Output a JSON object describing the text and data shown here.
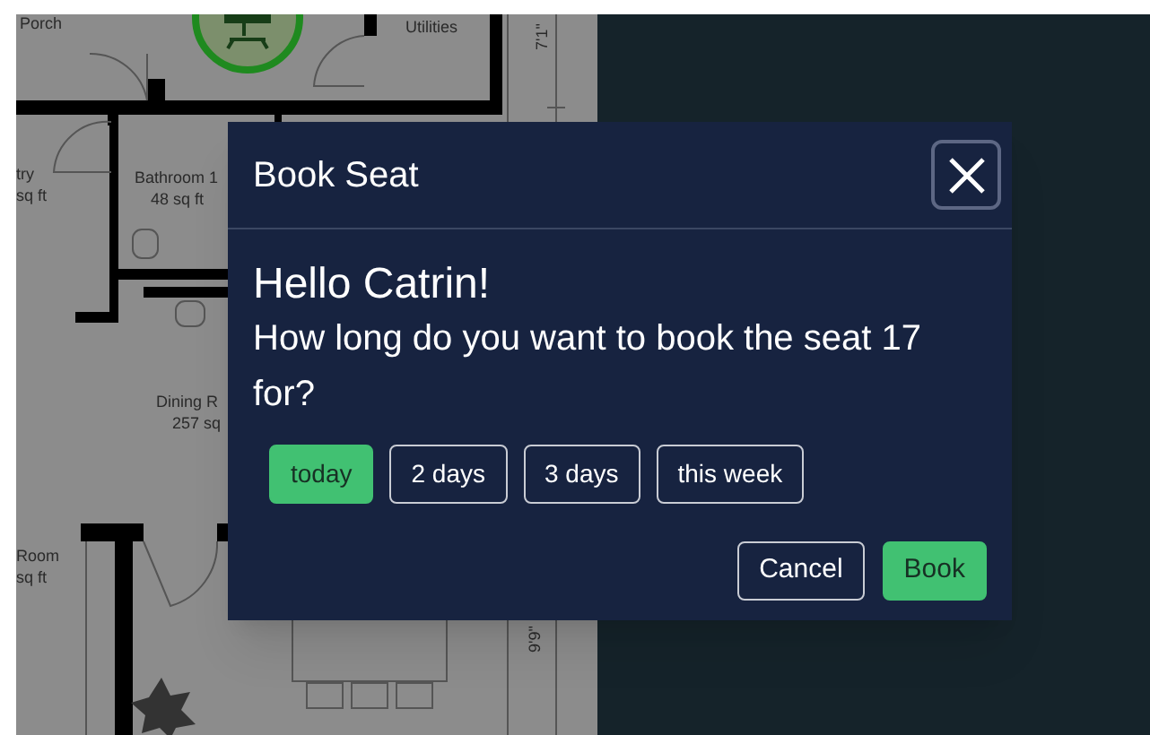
{
  "floor_plan": {
    "labels": [
      "Porch",
      "Utilities",
      "7'1\"",
      "try",
      "sq ft",
      "Bathroom 1",
      "48 sq ft",
      "Dining R",
      "257 sq",
      "Room",
      "sq ft",
      "9'9\""
    ]
  },
  "dialog": {
    "title": "Book Seat",
    "greeting": "Hello Catrin!",
    "question": "How long do you want to book the seat 17 for?",
    "options": [
      {
        "label": "today",
        "selected": true
      },
      {
        "label": "2 days",
        "selected": false
      },
      {
        "label": "3 days",
        "selected": false
      },
      {
        "label": "this week",
        "selected": false
      }
    ],
    "buttons": [
      {
        "label": "Cancel",
        "kind": "secondary"
      },
      {
        "label": "Book",
        "kind": "primary"
      }
    ]
  }
}
